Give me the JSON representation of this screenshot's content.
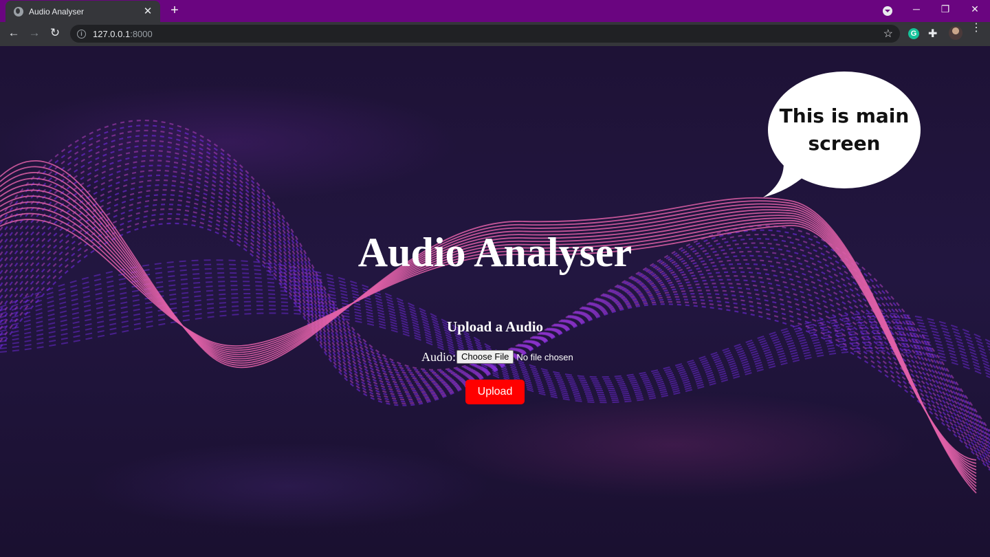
{
  "browser": {
    "tab_title": "Audio Analyser",
    "tab_close": "✕",
    "new_tab": "+",
    "url_host": "127.0.0.1",
    "url_port": ":8000",
    "info_glyph": "i",
    "back": "←",
    "forward": "→",
    "reload": "↻",
    "star": "☆",
    "extension_g": "G",
    "puzzle": "✚",
    "menu": "⋮",
    "minimize": "─",
    "restore": "❐",
    "close": "✕"
  },
  "page": {
    "title": "Audio Analyser",
    "subtitle": "Upload a Audio",
    "file_label": "Audio:",
    "choose_file": "Choose File",
    "file_status": "No file chosen",
    "upload": "Upload"
  },
  "callout": {
    "text": "This is main screen"
  },
  "colors": {
    "tabbar": "#6a0580",
    "upload_button": "#ff0000",
    "wave_pink": "#e060a8",
    "wave_purple": "#7a2cf0"
  }
}
